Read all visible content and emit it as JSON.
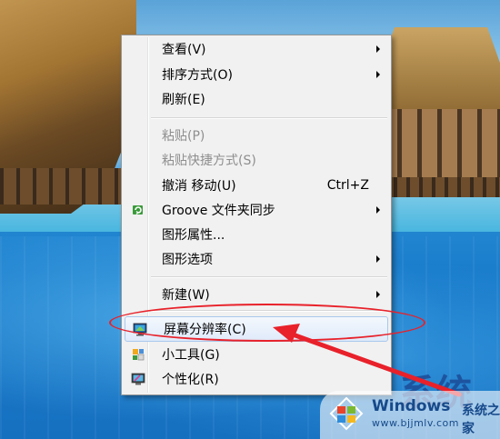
{
  "menu": {
    "items": [
      {
        "label": "查看(V)",
        "submenu": true
      },
      {
        "label": "排序方式(O)",
        "submenu": true
      },
      {
        "label": "刷新(E)"
      },
      {
        "label": "粘贴(P)",
        "disabled": true
      },
      {
        "label": "粘贴快捷方式(S)",
        "disabled": true
      },
      {
        "label": "撤消 移动(U)",
        "shortcut": "Ctrl+Z"
      },
      {
        "label": "Groove 文件夹同步",
        "submenu": true,
        "icon": "groove-sync-icon"
      },
      {
        "label": "图形属性..."
      },
      {
        "label": "图形选项",
        "submenu": true
      },
      {
        "label": "新建(W)",
        "submenu": true
      },
      {
        "label": "屏幕分辨率(C)",
        "icon": "display-resolution-icon",
        "highlighted": true
      },
      {
        "label": "小工具(G)",
        "icon": "gadgets-icon"
      },
      {
        "label": "个性化(R)",
        "icon": "personalize-icon"
      }
    ]
  },
  "watermark": {
    "brand": "Windows",
    "suffix": "系统之家",
    "url": "www.bjjmlv.com",
    "behind_text": "系统"
  },
  "colors": {
    "annotation_red": "#e8212a",
    "highlight_border": "#a8c8ec",
    "watermark_blue": "#174a8b"
  }
}
